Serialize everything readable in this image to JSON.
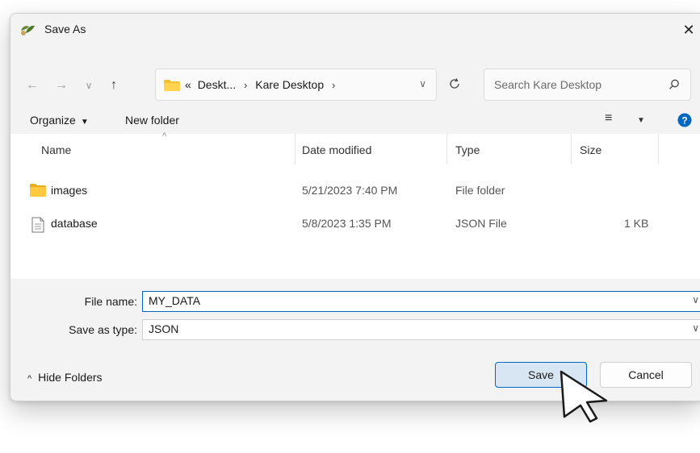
{
  "window": {
    "title": "Save As",
    "close_glyph": "✕"
  },
  "nav": {
    "back_glyph": "←",
    "forward_glyph": "→",
    "recent_glyph": "∨",
    "up_glyph": "↑",
    "refresh_glyph": "C"
  },
  "address": {
    "overflow": "«",
    "segments": [
      "Deskt...",
      "Kare Desktop"
    ],
    "separator": "›"
  },
  "search": {
    "placeholder": "Search Kare Desktop"
  },
  "toolbar": {
    "organize_label": "Organize",
    "organize_caret": "▼",
    "new_folder_label": "New folder",
    "view_glyph": "≡",
    "view_caret": "▼"
  },
  "columns": {
    "name": "Name",
    "date": "Date modified",
    "type": "Type",
    "size": "Size"
  },
  "files": [
    {
      "name": "images",
      "date": "5/21/2023 7:40 PM",
      "type": "File folder",
      "size": "",
      "icon": "folder-icon"
    },
    {
      "name": "database",
      "date": "5/8/2023 1:35 PM",
      "type": "JSON File",
      "size": "1 KB",
      "icon": "file-icon"
    }
  ],
  "form": {
    "file_name_label": "File name:",
    "file_name_value": "MY_DATA",
    "save_type_label": "Save as type:",
    "save_type_value": "JSON"
  },
  "footer": {
    "hide_folders_label": "Hide Folders",
    "hide_folders_glyph": "^",
    "save_label": "Save",
    "cancel_label": "Cancel"
  },
  "colors": {
    "accent": "#0067c0",
    "folder": "#f5c12e",
    "help": "#0067c0",
    "dialog_bg": "#f3f3f3"
  }
}
